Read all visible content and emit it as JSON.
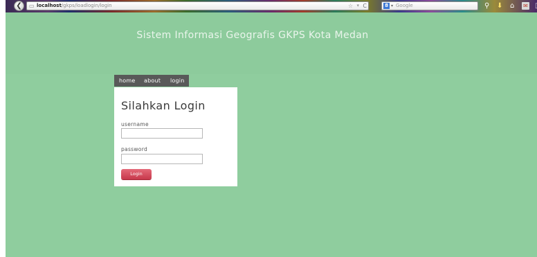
{
  "browser": {
    "url_host": "localhost",
    "url_path": "/gkps/loadlogin/login",
    "search_engine": "Google",
    "icons": {
      "back": "back-arrow-icon",
      "page": "page-icon",
      "star": "bookmark-star-icon",
      "reload": "reload-icon",
      "search_engine": "google-icon",
      "search": "search-icon",
      "download": "download-icon",
      "home": "home-icon",
      "mail": "mail-icon",
      "more": "more-icon"
    },
    "glyphs": {
      "back": "❮",
      "page": "▭",
      "star": "☆",
      "dropdown": "▾",
      "reload": "C",
      "google": "8",
      "search": "⚲",
      "download": "⬇",
      "home": "⌂",
      "mail": "✉",
      "more": "▯"
    }
  },
  "page": {
    "title": "Sistem Informasi Geografis GKPS Kota Medan",
    "nav": [
      "home",
      "about",
      "login"
    ],
    "login": {
      "heading": "Silahkan Login",
      "username_label": "username",
      "username_value": "",
      "password_label": "password",
      "password_value": "",
      "button_label": "Login"
    }
  },
  "colors": {
    "page_background": "#8fcd9e",
    "nav_background": "#595959",
    "button": "#d44d5f",
    "panel": "#ffffff"
  }
}
